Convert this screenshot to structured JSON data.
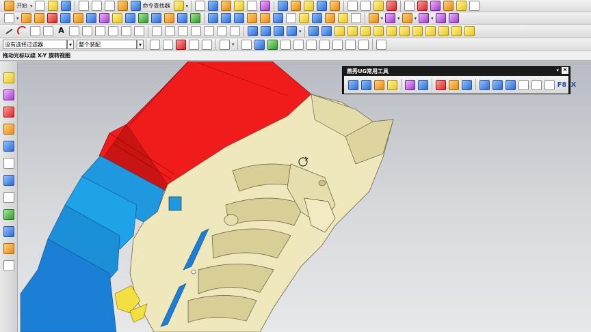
{
  "toolbar_row1": {
    "start_menu": "开始",
    "command_finder": "命令查找器"
  },
  "selection_bar": {
    "filter_value": "没有选择过滤器",
    "assembly_value": "整个装配"
  },
  "status_bar": {
    "prompt": "拖动光标以绕 X-Y 旋转视图"
  },
  "floating_toolbar": {
    "title": "燕秀UG常用工具",
    "close_label": "✕",
    "menu_arrow": "▾",
    "text_buttons": [
      "F8",
      "X"
    ]
  },
  "colors": {
    "red_face": "#f01c1c",
    "cyan_face": "#1fa3e8",
    "blue_face": "#1c7fd6",
    "beige_face": "#efe8bc",
    "yellow_part": "#f2e040"
  },
  "rotate_cursor_icon": "rotate-view-cursor-icon"
}
